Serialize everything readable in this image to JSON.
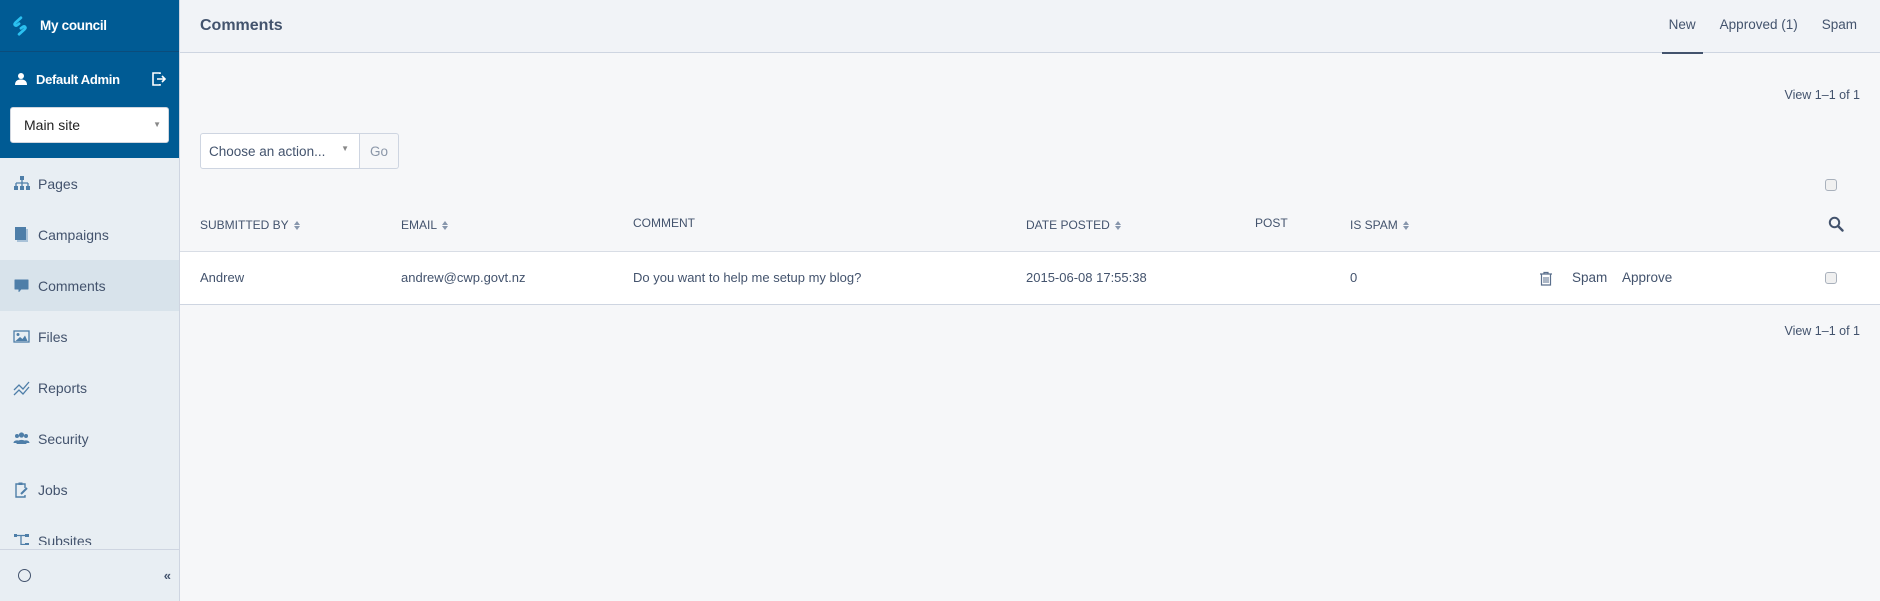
{
  "brand": {
    "name": "My council",
    "logo_icon": "silverstripe-logo-icon",
    "color": "#005b94"
  },
  "user": {
    "name": "Default Admin",
    "user_icon": "user-icon",
    "logout_icon": "logout-icon"
  },
  "site_select": {
    "value": "Main site"
  },
  "sidebar": {
    "items": [
      {
        "label": "Pages",
        "icon": "sitemap-icon",
        "active": false
      },
      {
        "label": "Campaigns",
        "icon": "campaigns-icon",
        "active": false
      },
      {
        "label": "Comments",
        "icon": "comment-icon",
        "active": true
      },
      {
        "label": "Files",
        "icon": "image-icon",
        "active": false
      },
      {
        "label": "Reports",
        "icon": "chart-line-icon",
        "active": false
      },
      {
        "label": "Security",
        "icon": "users-icon",
        "active": false
      },
      {
        "label": "Jobs",
        "icon": "clipboard-edit-icon",
        "active": false
      },
      {
        "label": "Subsites",
        "icon": "tree-icon",
        "active": false
      }
    ],
    "collapse_label": "«"
  },
  "header": {
    "title": "Comments",
    "tabs": [
      {
        "label": "New",
        "active": true
      },
      {
        "label": "Approved (1)",
        "active": false
      },
      {
        "label": "Spam",
        "active": false
      }
    ]
  },
  "pagination": {
    "top": "View 1–1 of 1",
    "bottom": "View 1–1 of 1"
  },
  "bulk_actions": {
    "select_value": "Choose an action...",
    "go_label": "Go"
  },
  "table": {
    "columns": [
      {
        "label": "Submitted By",
        "sortable": true
      },
      {
        "label": "Email",
        "sortable": true
      },
      {
        "label": "Comment",
        "sortable": false
      },
      {
        "label": "Date Posted",
        "sortable": true
      },
      {
        "label": "Post",
        "sortable": false
      },
      {
        "label": "Is Spam",
        "sortable": true
      }
    ],
    "rows": [
      {
        "submitted_by": "Andrew",
        "email": "andrew@cwp.govt.nz",
        "comment": "Do you want to help me setup my blog?",
        "date_posted": "2015-06-08 17:55:38",
        "post": "",
        "is_spam": "0",
        "actions": {
          "spam": "Spam",
          "approve": "Approve"
        }
      }
    ]
  }
}
